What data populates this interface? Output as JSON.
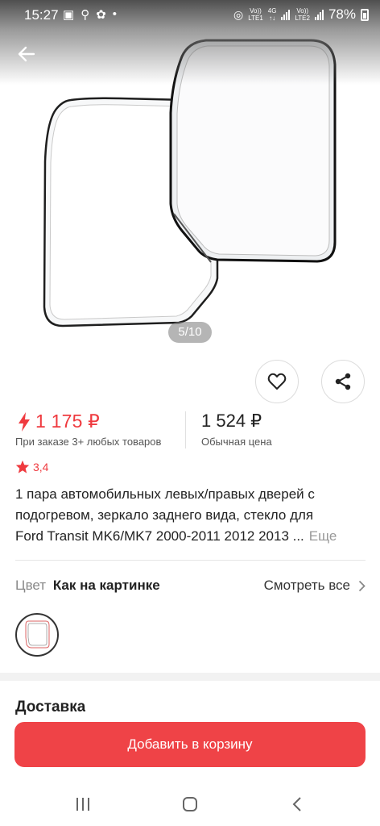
{
  "status_bar": {
    "time": "15:27",
    "sim1_label_top": "Vo))",
    "sim1_label_bottom": "LTE1",
    "network_label": "4G",
    "sim2_label_top": "Vo))",
    "sim2_label_bottom": "LTE2",
    "battery": "78%",
    "icons": [
      "image-icon",
      "search-icon",
      "apps-icon",
      "dot-icon",
      "hotspot-icon",
      "signal-icon",
      "battery-icon"
    ]
  },
  "gallery": {
    "page_indicator": "5/10",
    "back_icon": "back-arrow-icon"
  },
  "actions": {
    "favorite_icon": "heart-icon",
    "share_icon": "share-icon"
  },
  "price": {
    "sale_price": "1 175 ₽",
    "sale_note": "При заказе 3+ любых товаров",
    "regular_price": "1 524 ₽",
    "regular_note": "Обычная цена",
    "accent_color": "#ef3a3f"
  },
  "rating": {
    "value": "3,4"
  },
  "product": {
    "title_line1": "1 пара автомобильных левых/правых дверей с",
    "title_line2": "подогревом, зеркало заднего вида, стекло для",
    "title_line3": "Ford Transit MK6/MK7 2000-2011 2012 2013 ...",
    "more_label": "Еще"
  },
  "color": {
    "label": "Цвет",
    "value": "Как на картинке",
    "see_all": "Смотреть все"
  },
  "delivery": {
    "title": "Доставка"
  },
  "cart": {
    "button_label": "Добавить в корзину",
    "button_color": "#ef4347"
  },
  "nav": {
    "icons": [
      "recent-apps-icon",
      "home-icon",
      "back-icon"
    ]
  }
}
